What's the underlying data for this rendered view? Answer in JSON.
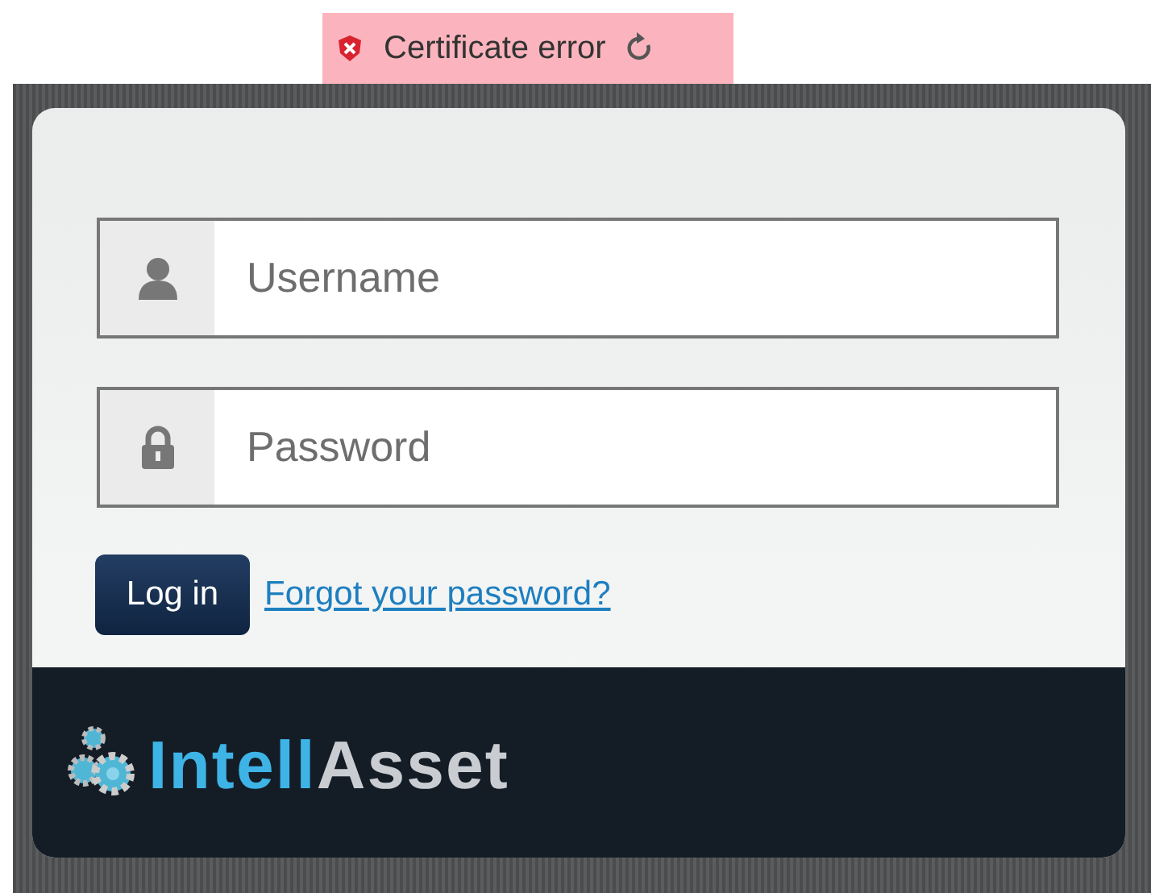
{
  "certificate_warning": {
    "text": "Certificate error"
  },
  "form": {
    "fields": [
      {
        "kind": "user",
        "placeholder": "Username"
      },
      {
        "kind": "password",
        "placeholder": "Password"
      }
    ],
    "login_button": "Log in",
    "forgot_link": "Forgot your password?"
  },
  "logo": {
    "parts": [
      "Intell",
      "Asset"
    ]
  }
}
